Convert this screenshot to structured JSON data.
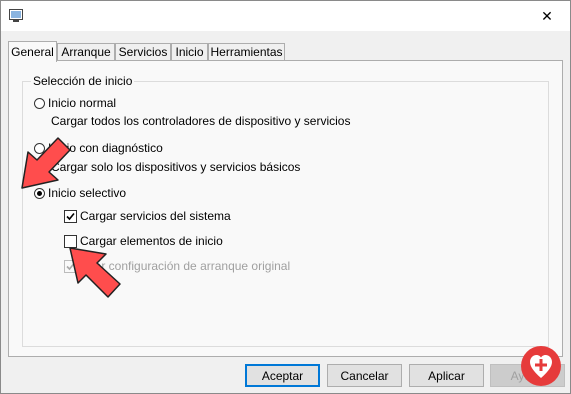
{
  "window": {
    "close_glyph": "✕",
    "icon": "system-config-icon"
  },
  "tabs": [
    {
      "label": "General",
      "active": true
    },
    {
      "label": "Arranque",
      "active": false
    },
    {
      "label": "Servicios",
      "active": false
    },
    {
      "label": "Inicio",
      "active": false
    },
    {
      "label": "Herramientas",
      "active": false
    }
  ],
  "startup_group": {
    "label": "Selección de inicio",
    "normal": {
      "label": "Inicio normal",
      "description": "Cargar todos los controladores de dispositivo y servicios",
      "selected": false
    },
    "diagnostic": {
      "label": "Inicio con diagnóstico",
      "description": "Cargar solo los dispositivos y servicios básicos",
      "selected": false
    },
    "selective": {
      "label": "Inicio selectivo",
      "selected": true
    },
    "options": [
      {
        "label": "Cargar servicios del sistema",
        "checked": true,
        "enabled": true
      },
      {
        "label": "Cargar elementos de inicio",
        "checked": false,
        "enabled": true
      },
      {
        "label": "Usar configuración de arranque original",
        "checked": true,
        "enabled": false
      }
    ]
  },
  "buttons": {
    "ok": "Aceptar",
    "cancel": "Cancelar",
    "apply": "Aplicar",
    "help": "Ayuda"
  },
  "colors": {
    "accent": "#0078d7",
    "arrow": "#ff4d4d",
    "logo": "#e63b3b"
  }
}
